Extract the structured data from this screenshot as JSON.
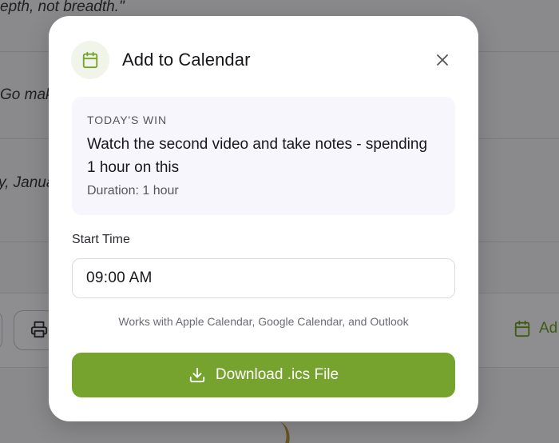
{
  "background": {
    "quote_fragment": "epth, not breadth.\"",
    "go_fragment": "Go mak",
    "date_fragment": "y, Janua",
    "add_fragment": "Ad"
  },
  "modal": {
    "title": "Add to Calendar",
    "header_icon": "calendar-icon",
    "close_icon": "close-icon",
    "win_card": {
      "label": "TODAY'S WIN",
      "title": "Watch the second video and take notes - spending 1 hour on this",
      "duration": "Duration: 1 hour"
    },
    "start_time": {
      "label": "Start Time",
      "value": "09:00 AM"
    },
    "compat_note": "Works with Apple Calendar, Google Calendar, and Outlook",
    "download_button": {
      "label": "Download .ics File",
      "icon": "download-icon"
    }
  },
  "colors": {
    "accent": "#76a22e",
    "overlay": "#8a8a8c",
    "card_bg": "#f7f6fd"
  }
}
